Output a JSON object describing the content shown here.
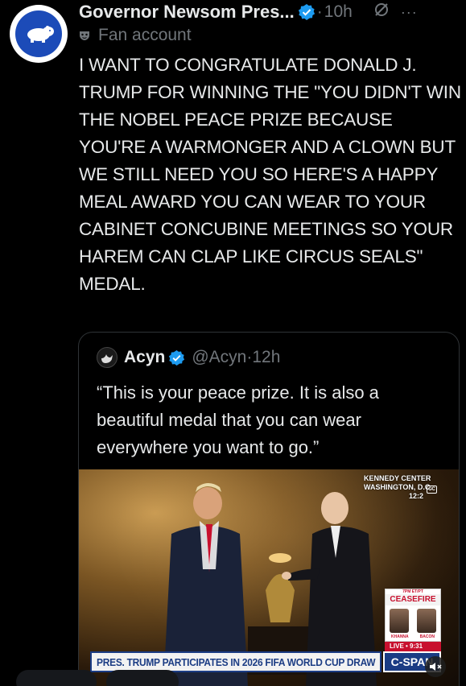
{
  "author": {
    "display_name": "Governor Newsom Pres...",
    "time": "10h",
    "dot": "·",
    "label": "Fan account",
    "icons": [
      "hippo-avatar-icon",
      "verified-badge-icon",
      "grok-icon",
      "more-icon",
      "mask-icon"
    ]
  },
  "tweet": {
    "text": "I WANT TO CONGRATULATE DONALD J. TRUMP FOR WINNING THE \"YOU DIDN'T WIN THE NOBEL PEACE PRIZE BECAUSE YOU'RE A WARMONGER AND A CLOWN BUT WE STILL NEED YOU SO HERE'S A HAPPY MEAL AWARD YOU CAN WEAR TO YOUR CABINET CONCUBINE MEETINGS SO YOUR HAREM CAN CLAP LIKE CIRCUS SEALS\" MEDAL."
  },
  "quote": {
    "name": "Acyn",
    "handle": "@Acyn",
    "dot": "·",
    "time": "12h",
    "text": "“This is your peace prize. It is also a beautiful medal that you can wear everywhere you want to go.”",
    "video": {
      "location_line1": "KENNEDY CENTER",
      "location_line2": "WASHINGTON, D.C.",
      "clock": "12:2",
      "cc": "CC",
      "ceasefire_header": "7PM ET/PT",
      "ceasefire_title": "CEASEFIRE",
      "ceasefire_name1": "KHANNA",
      "ceasefire_name2": "BACON",
      "live_label": "LIVE • 9:31",
      "chyron": "PRES. TRUMP PARTICIPATES IN 2026 FIFA WORLD CUP DRAW",
      "network": "C-SPAN"
    }
  },
  "colors": {
    "background": "#000000",
    "verified": "#1d9bf0",
    "muted_text": "#71767b",
    "avatar_blue": "#1c4bb8"
  }
}
